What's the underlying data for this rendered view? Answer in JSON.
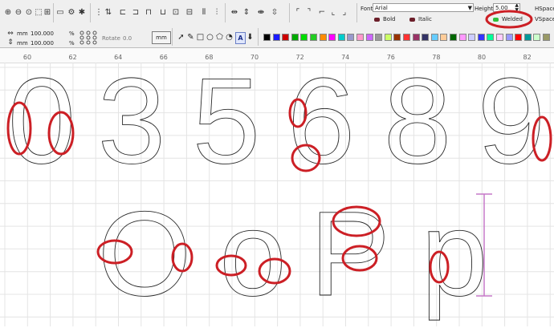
{
  "font": {
    "label": "Font",
    "value": "Arial"
  },
  "height": {
    "label": "Height",
    "value": "5.00"
  },
  "hspace_label": "HSpace",
  "vspace_label": "VSpace",
  "bold_label": "Bold",
  "italic_label": "Italic",
  "welded_label": "Welded",
  "size": {
    "unit1": "mm",
    "value1": "100.000",
    "pct1": "%",
    "unit2": "mm",
    "value2": "100.000",
    "pct2": "%"
  },
  "rotate": {
    "label": "Rotate",
    "value": "0.0"
  },
  "mm_button": "mm",
  "ruler": [
    "60",
    "62",
    "64",
    "66",
    "68",
    "70",
    "72",
    "74",
    "76",
    "78",
    "80",
    "82"
  ],
  "canvas_top_glyphs": [
    "0",
    "3",
    "5",
    "6",
    "8",
    "9"
  ],
  "canvas_bottom_glyphs": [
    "O",
    "o",
    "P",
    "p"
  ],
  "palette": [
    "#000000",
    "#1a1aff",
    "#cc0000",
    "#00aa00",
    "#00dd00",
    "#22cc22",
    "#ff8c00",
    "#ff00ff",
    "#00cccc",
    "#9999cc",
    "#ff99cc",
    "#cc66ff",
    "#999999",
    "#ccff66",
    "#993300",
    "#ff3333",
    "#993366",
    "#333366",
    "#66ccff",
    "#ffcc99",
    "#006600",
    "#ff99ff",
    "#ccccff",
    "#3333ff",
    "#00ff99",
    "#ffccff",
    "#9999ff",
    "#ff0000",
    "#009999",
    "#ccffcc",
    "#999966"
  ],
  "icons": {
    "zoom_in": "zoom-in-icon",
    "zoom_out": "zoom-out-icon",
    "zoom_fit": "zoom-fit-icon",
    "select_area": "select-area-icon",
    "monitor": "monitor-icon",
    "settings": "gear-icon",
    "tool": "asterisk-icon"
  },
  "annotation_color": "#cc1f25",
  "height_marker_color": "#c678c8"
}
